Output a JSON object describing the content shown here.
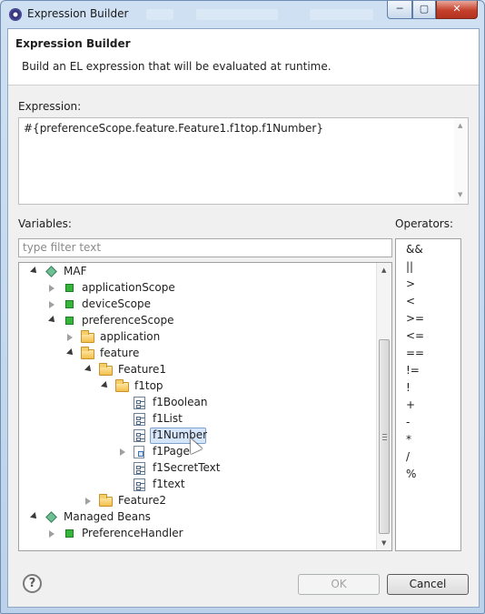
{
  "window": {
    "title": "Expression Builder",
    "controls": {
      "minimize": "─",
      "maximize": "▢",
      "close": "✕"
    }
  },
  "header": {
    "title": "Expression Builder",
    "description": "Build an EL expression that will be evaluated at runtime."
  },
  "expression": {
    "label": "Expression:",
    "value": "#{preferenceScope.feature.Feature1.f1top.f1Number}"
  },
  "variables": {
    "label": "Variables:",
    "filter_placeholder": "type filter text",
    "tree": [
      {
        "label": "MAF",
        "icon": "diamond-icon",
        "toggle": "expanded"
      },
      {
        "label": "applicationScope",
        "icon": "scope-icon",
        "toggle": "collapsed"
      },
      {
        "label": "deviceScope",
        "icon": "scope-icon",
        "toggle": "collapsed"
      },
      {
        "label": "preferenceScope",
        "icon": "scope-icon",
        "toggle": "expanded"
      },
      {
        "label": "application",
        "icon": "folder-icon",
        "toggle": "collapsed"
      },
      {
        "label": "feature",
        "icon": "folder-icon",
        "toggle": "expanded"
      },
      {
        "label": "Feature1",
        "icon": "folder-icon",
        "toggle": "expanded"
      },
      {
        "label": "f1top",
        "icon": "folder-icon",
        "toggle": "expanded"
      },
      {
        "label": "f1Boolean",
        "icon": "property-icon",
        "toggle": "none"
      },
      {
        "label": "f1List",
        "icon": "property-icon",
        "toggle": "none"
      },
      {
        "label": "f1Number",
        "icon": "property-icon",
        "toggle": "none",
        "selected": true
      },
      {
        "label": "f1Page",
        "icon": "page-icon",
        "toggle": "collapsed"
      },
      {
        "label": "f1SecretText",
        "icon": "property-icon",
        "toggle": "none"
      },
      {
        "label": "f1text",
        "icon": "property-icon",
        "toggle": "none"
      },
      {
        "label": "Feature2",
        "icon": "folder-icon",
        "toggle": "collapsed"
      },
      {
        "label": "Managed Beans",
        "icon": "diamond-icon",
        "toggle": "expanded"
      },
      {
        "label": "PreferenceHandler",
        "icon": "scope-icon",
        "toggle": "collapsed"
      }
    ]
  },
  "operators": {
    "label": "Operators:",
    "items": [
      "&&",
      "||",
      ">",
      "<",
      ">=",
      "<=",
      "==",
      "!=",
      "!",
      "+",
      "-",
      "*",
      "/",
      "%"
    ]
  },
  "buttons": {
    "help": "?",
    "ok": "OK",
    "cancel": "Cancel"
  }
}
